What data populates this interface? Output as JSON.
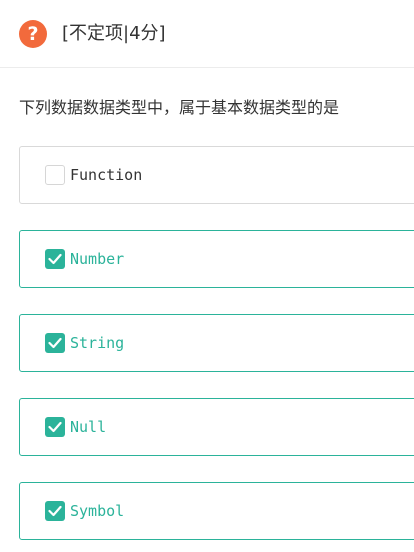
{
  "question": {
    "icon": "question-mark-icon",
    "icon_glyph": "?",
    "type_label": "[不定项|4分]",
    "text": "下列数据数据类型中，属于基本数据类型的是"
  },
  "options": [
    {
      "label": "Function",
      "checked": false
    },
    {
      "label": "Number",
      "checked": true
    },
    {
      "label": "String",
      "checked": true
    },
    {
      "label": "Null",
      "checked": true
    },
    {
      "label": "Symbol",
      "checked": true
    }
  ],
  "colors": {
    "accent": "#2bb39a",
    "question_icon": "#f26a3c",
    "text": "#333333",
    "border": "#d9d9d9"
  }
}
